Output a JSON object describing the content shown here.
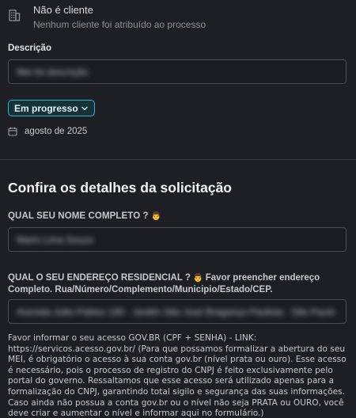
{
  "client": {
    "title": "Não é cliente",
    "subtitle": "Nenhum cliente foi atribuído ao processo"
  },
  "description": {
    "label": "Descrição",
    "value": "Mei foi descrição"
  },
  "status": {
    "label": "Em progresso"
  },
  "date": {
    "value": "agosto de 2025"
  },
  "section": {
    "title": "Confira os detalhes da solicitação"
  },
  "questions": {
    "name": {
      "label": "QUAL SEU NOME COMPLETO ?",
      "value": "Mario Lima Souza"
    },
    "address": {
      "label": "QUAL O SEU ENDEREÇO RESIDENCIAL ?",
      "label_tail": "Favor preencher endereço Completo. Rua/Número/Complemento/Municipio/Estado/CEP.",
      "value": "Avenida João Pablos 190 - Jardim São José Bragança Paulista - São Paulo"
    }
  },
  "help_text": "Favor informar o seu acesso GOV.BR (CPF + SENHA) - LINK: https://servicos.acesso.gov.br/ (Para que possamos formalizar a abertura do seu MEI, é obrigatório o acesso à sua conta gov.br (nível prata ou ouro). Esse acesso é necessário, pois o processo de registro do CNPJ é feito exclusivamente pelo portal do governo. Ressaltamos que esse acesso será utilizado apenas para a formalização do CNPJ, garantindo total sigilo e segurança das suas informações. Caso ainda não possua a conta gov.br ou o nível não seja PRATA ou OURO, você deve criar e aumentar o nível e informar aqui no formulário.)",
  "colors": {
    "background": "#1e1f25",
    "accent": "#2fb3c4",
    "border": "#4a4c56"
  },
  "icons": {
    "client": "building-icon",
    "status": "chevron-down-icon",
    "date": "calendar-icon",
    "person": "person-emoji"
  }
}
